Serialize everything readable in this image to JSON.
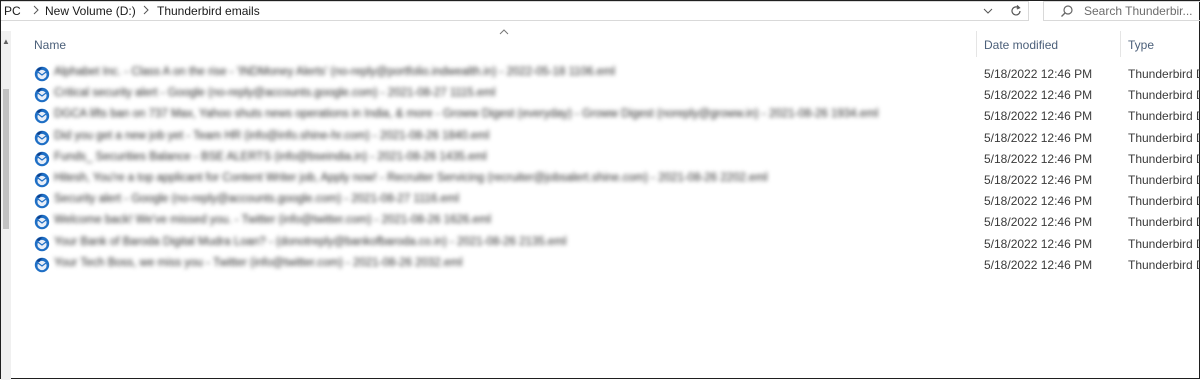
{
  "address": {
    "crumbs": [
      "PC",
      "New Volume (D:)",
      "Thunderbird emails"
    ]
  },
  "search": {
    "placeholder": "Search Thunderbir..."
  },
  "columns": {
    "name": "Name",
    "date": "Date modified",
    "type": "Type"
  },
  "files": [
    {
      "name": "Alphabet Inc. - Class A on the rise - 'INDMoney Alerts' (no-reply@portfolio.indwealth.in) - 2022-05-18 1106.eml",
      "date": "5/18/2022 12:46 PM",
      "type": "Thunderbird D"
    },
    {
      "name": "Critical security alert - Google (no-reply@accounts.google.com) - 2021-08-27 1115.eml",
      "date": "5/18/2022 12:46 PM",
      "type": "Thunderbird D"
    },
    {
      "name": "DGCA lifts ban on 737 Max, Yahoo shuts news operations in India, & more - Groww Digest (everyday) - Groww Digest (noreply@groww.in) - 2021-08-26 1934.eml",
      "date": "5/18/2022 12:46 PM",
      "type": "Thunderbird D"
    },
    {
      "name": "Did you get a new job yet - Team HR (info@info.shine-hr.com) - 2021-08-26 1840.eml",
      "date": "5/18/2022 12:46 PM",
      "type": "Thunderbird D"
    },
    {
      "name": "Funds_ Securities Balance - BSE ALERTS (info@bseindia.in) - 2021-08-26 1435.eml",
      "date": "5/18/2022 12:46 PM",
      "type": "Thunderbird D"
    },
    {
      "name": "Hitesh, You're a top applicant for Content Writer job, Apply now! - Recruiter Servicing (recruiter@jobsalert.shine.com) - 2021-08-26 2202.eml",
      "date": "5/18/2022 12:46 PM",
      "type": "Thunderbird D"
    },
    {
      "name": "Security alert - Google (no-reply@accounts.google.com) - 2021-08-27 1116.eml",
      "date": "5/18/2022 12:46 PM",
      "type": "Thunderbird D"
    },
    {
      "name": "Welcome back! We've missed you. - Twitter (info@twitter.com) - 2021-08-26 1626.eml",
      "date": "5/18/2022 12:46 PM",
      "type": "Thunderbird D"
    },
    {
      "name": "Your Bank of Baroda Digital Mudra Loan? - (donotreply@bankofbaroda.co.in) - 2021-08-26 2135.eml",
      "date": "5/18/2022 12:46 PM",
      "type": "Thunderbird D"
    },
    {
      "name": "Your Tech Boss, we miss you - Twitter (info@twitter.com) - 2021-08-26 2032.eml",
      "date": "5/18/2022 12:46 PM",
      "type": "Thunderbird D"
    }
  ],
  "colors": {
    "header_text": "#4c607a",
    "thunderbird_blue": "#1f6fc5"
  }
}
